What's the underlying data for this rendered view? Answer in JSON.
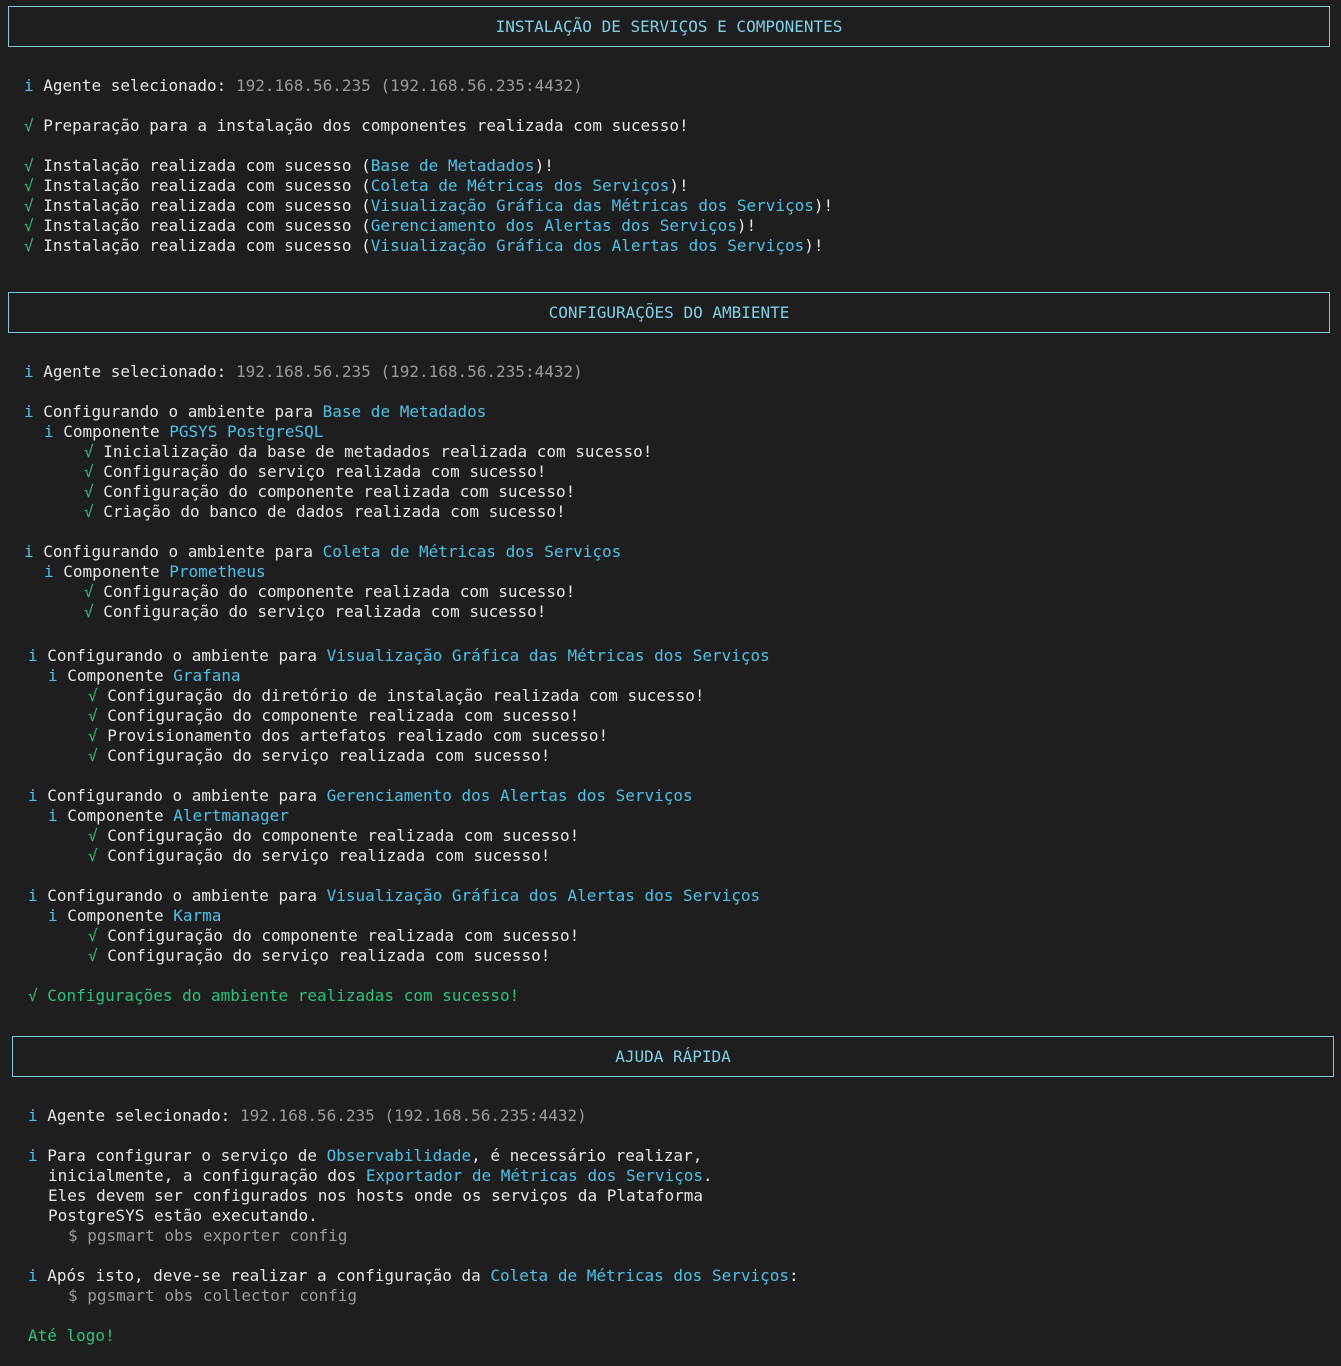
{
  "sections": {
    "install": {
      "title": "INSTALAÇÃO DE SERVIÇOS E COMPONENTES",
      "agent_label": "Agente selecionado:",
      "agent_value": "192.168.56.235 (192.168.56.235:4432)",
      "prep": "Preparação para a instalação dos componentes realizada com sucesso!",
      "install_prefix": "Instalação realizada com sucesso (",
      "items": [
        "Base de Metadados",
        "Coleta de Métricas dos Serviços",
        "Visualização Gráfica das Métricas dos Serviços",
        "Gerenciamento dos Alertas dos Serviços",
        "Visualização Gráfica dos Alertas dos Serviços"
      ],
      "suffix": ")!"
    },
    "config": {
      "title": "CONFIGURAÇÕES DO AMBIENTE",
      "agent_label": "Agente selecionado:",
      "agent_value": "192.168.56.235 (192.168.56.235:4432)",
      "configuring_label": "Configurando o ambiente para",
      "component_label": "Componente",
      "groups": [
        {
          "target": "Base de Metadados",
          "component": "PGSYS PostgreSQL",
          "steps": [
            "Inicialização da base de metadados realizada com sucesso!",
            "Configuração do serviço realizada com sucesso!",
            "Configuração do componente realizada com sucesso!",
            "Criação do banco de dados realizada com sucesso!"
          ]
        },
        {
          "target": "Coleta de Métricas dos Serviços",
          "component": "Prometheus",
          "steps": [
            "Configuração do componente realizada com sucesso!",
            "Configuração do serviço realizada com sucesso!"
          ]
        },
        {
          "target": "Visualização Gráfica das Métricas dos Serviços",
          "component": "Grafana",
          "steps": [
            "Configuração do diretório de instalação realizada com sucesso!",
            "Configuração do componente realizada com sucesso!",
            "Provisionamento dos artefatos realizado com sucesso!",
            "Configuração do serviço realizada com sucesso!"
          ]
        },
        {
          "target": "Gerenciamento dos Alertas dos Serviços",
          "component": "Alertmanager",
          "steps": [
            "Configuração do componente realizada com sucesso!",
            "Configuração do serviço realizada com sucesso!"
          ]
        },
        {
          "target": "Visualização Gráfica dos Alertas dos Serviços",
          "component": "Karma",
          "steps": [
            "Configuração do componente realizada com sucesso!",
            "Configuração do serviço realizada com sucesso!"
          ]
        }
      ],
      "final": "Configurações do ambiente realizadas com sucesso!"
    },
    "help": {
      "title": "AJUDA RÁPIDA",
      "agent_label": "Agente selecionado:",
      "agent_value": "192.168.56.235 (192.168.56.235:4432)",
      "p1_a": "Para configurar o serviço de ",
      "p1_hl": "Observabilidade",
      "p1_b": ", é necessário realizar,",
      "p2_a": "inicialmente, a configuração dos ",
      "p2_hl": "Exportador de Métricas dos Serviços",
      "p2_b": ".",
      "p3": "Eles devem ser configurados nos hosts onde os serviços da Plataforma",
      "p4": "PostgreSYS estão executando.",
      "cmd1": "$ pgsmart obs exporter config",
      "p5_a": "Após isto, deve-se realizar a configuração da ",
      "p5_hl": "Coleta de Métricas dos Serviços",
      "p5_b": ":",
      "cmd2": "$ pgsmart obs collector config",
      "bye": "Até logo!"
    }
  },
  "icons": {
    "info": "i",
    "check": "√"
  },
  "colors": {
    "accent": "#4fc1e9",
    "success": "#2ec27e",
    "border": "#7fc8d9",
    "background": "#1e1e1e"
  }
}
